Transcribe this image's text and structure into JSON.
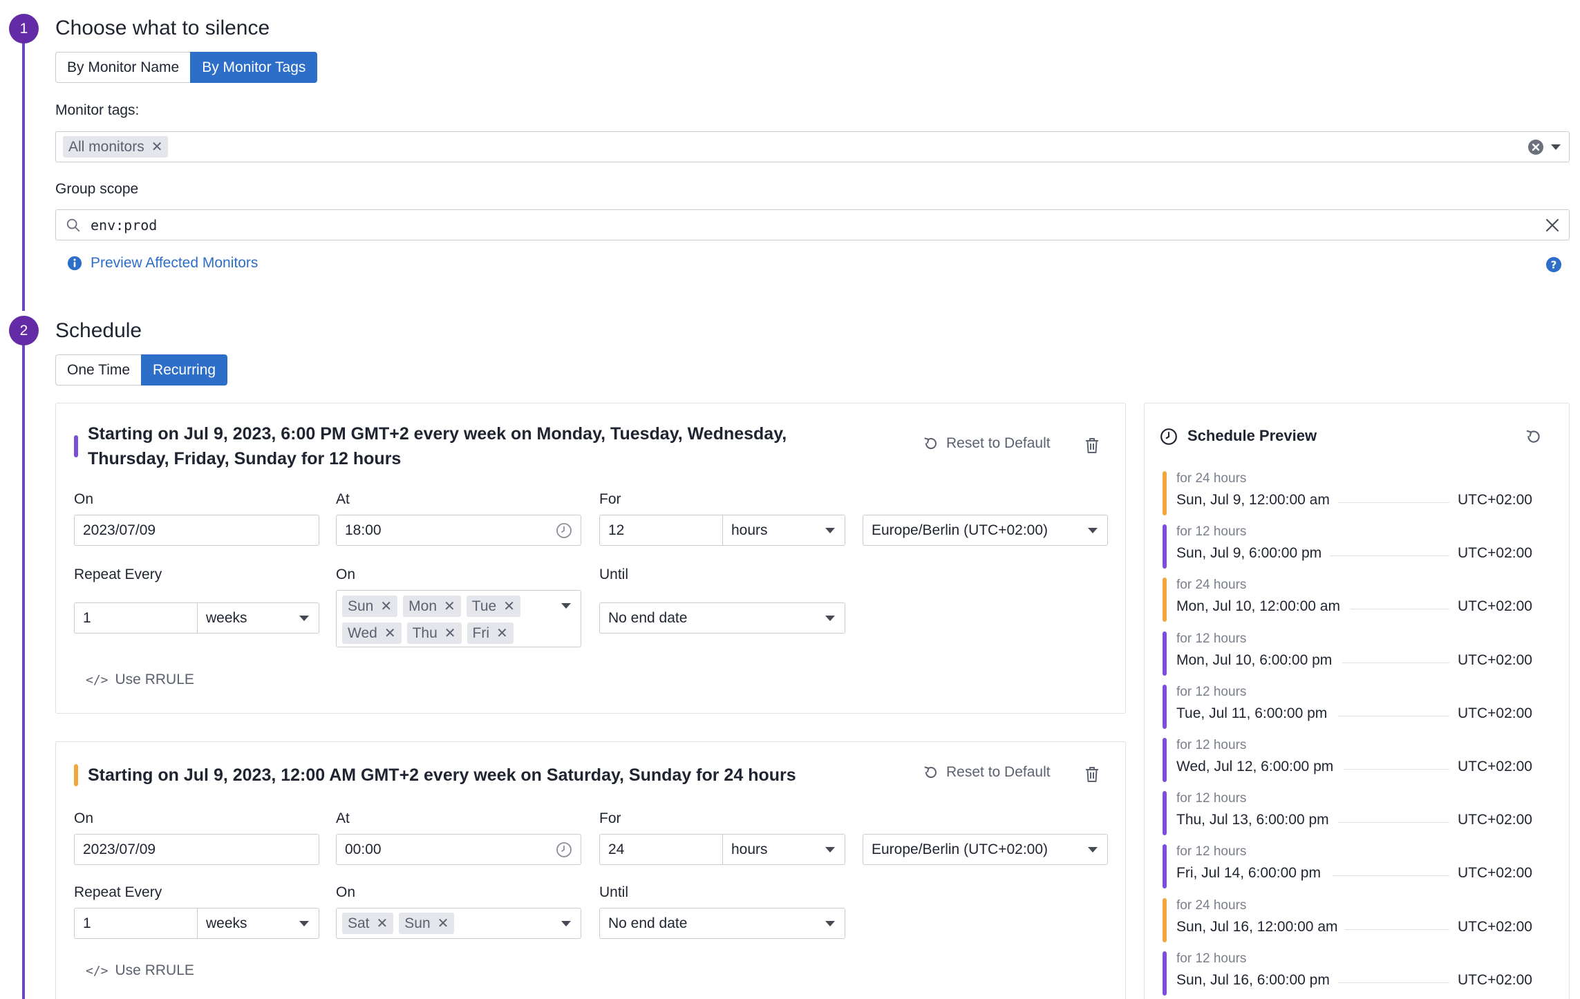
{
  "step1": {
    "number": "1",
    "title": "Choose what to silence",
    "tabs": [
      {
        "label": "By Monitor Name",
        "active": false
      },
      {
        "label": "By Monitor Tags",
        "active": true
      }
    ],
    "monitor_tags_label": "Monitor tags:",
    "monitor_tags": [
      "All monitors"
    ],
    "group_scope_label": "Group scope",
    "group_scope_value": "env:prod",
    "preview_link": "Preview Affected Monitors"
  },
  "step2": {
    "number": "2",
    "title": "Schedule",
    "tabs": [
      {
        "label": "One Time",
        "active": false
      },
      {
        "label": "Recurring",
        "active": true
      }
    ]
  },
  "rules": [
    {
      "accent": "#7b4fd8",
      "summary": "Starting on Jul 9, 2023, 6:00 PM GMT+2 every week on Monday, Tuesday, Wednesday, Thursday, Friday, Sunday for 12 hours",
      "reset_label": "Reset to Default",
      "on_label": "On",
      "on_value": "2023/07/09",
      "at_label": "At",
      "at_value": "18:00",
      "for_label": "For",
      "for_value": "12",
      "for_unit": "hours",
      "timezone": "Europe/Berlin (UTC+02:00)",
      "repeat_label": "Repeat Every",
      "repeat_value": "1",
      "repeat_unit": "weeks",
      "days_label": "On",
      "days": [
        "Sun",
        "Mon",
        "Tue",
        "Wed",
        "Thu",
        "Fri"
      ],
      "until_label": "Until",
      "until_value": "No end date",
      "rrule_label": "Use RRULE"
    },
    {
      "accent": "#f0a73e",
      "summary": "Starting on Jul 9, 2023, 12:00 AM GMT+2 every week on Saturday, Sunday for 24 hours",
      "reset_label": "Reset to Default",
      "on_label": "On",
      "on_value": "2023/07/09",
      "at_label": "At",
      "at_value": "00:00",
      "for_label": "For",
      "for_value": "24",
      "for_unit": "hours",
      "timezone": "Europe/Berlin (UTC+02:00)",
      "repeat_label": "Repeat Every",
      "repeat_value": "1",
      "repeat_unit": "weeks",
      "days_label": "On",
      "days": [
        "Sat",
        "Sun"
      ],
      "until_label": "Until",
      "until_value": "No end date",
      "rrule_label": "Use RRULE"
    }
  ],
  "preview": {
    "title": "Schedule Preview",
    "items": [
      {
        "duration": "for 24 hours",
        "when": "Sun, Jul 9, 12:00:00 am",
        "tz": "UTC+02:00",
        "color": "#f0a73e"
      },
      {
        "duration": "for 12 hours",
        "when": "Sun, Jul 9, 6:00:00 pm",
        "tz": "UTC+02:00",
        "color": "#7b4fd8"
      },
      {
        "duration": "for 24 hours",
        "when": "Mon, Jul 10, 12:00:00 am",
        "tz": "UTC+02:00",
        "color": "#f0a73e"
      },
      {
        "duration": "for 12 hours",
        "when": "Mon, Jul 10, 6:00:00 pm",
        "tz": "UTC+02:00",
        "color": "#7b4fd8"
      },
      {
        "duration": "for 12 hours",
        "when": "Tue, Jul 11, 6:00:00 pm",
        "tz": "UTC+02:00",
        "color": "#7b4fd8"
      },
      {
        "duration": "for 12 hours",
        "when": "Wed, Jul 12, 6:00:00 pm",
        "tz": "UTC+02:00",
        "color": "#7b4fd8"
      },
      {
        "duration": "for 12 hours",
        "when": "Thu, Jul 13, 6:00:00 pm",
        "tz": "UTC+02:00",
        "color": "#7b4fd8"
      },
      {
        "duration": "for 12 hours",
        "when": "Fri, Jul 14, 6:00:00 pm",
        "tz": "UTC+02:00",
        "color": "#7b4fd8"
      },
      {
        "duration": "for 24 hours",
        "when": "Sun, Jul 16, 12:00:00 am",
        "tz": "UTC+02:00",
        "color": "#f0a73e"
      },
      {
        "duration": "for 12 hours",
        "when": "Sun, Jul 16, 6:00:00 pm",
        "tz": "UTC+02:00",
        "color": "#7b4fd8"
      }
    ]
  },
  "colors": {
    "brand": "#632ca6",
    "primary": "#2d6ec9",
    "link": "#2d6ec9"
  },
  "icons": {
    "clear": "clear-circle-icon",
    "search": "search-icon",
    "close": "close-icon",
    "info": "info-icon",
    "help": "help-icon",
    "reset": "reset-icon",
    "trash": "trash-icon",
    "clock": "clock-icon",
    "code": "code-icon"
  }
}
